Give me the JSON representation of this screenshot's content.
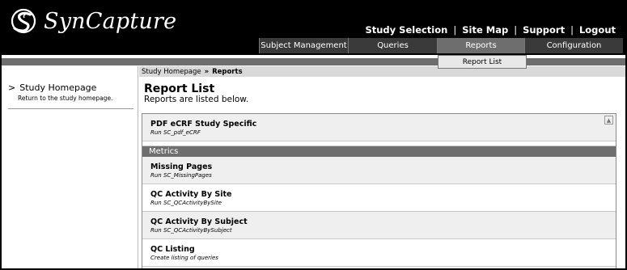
{
  "brand": {
    "name": "SynCapture",
    "logo_icon": "syncapture-s-logo-icon"
  },
  "top_links": {
    "study_selection": "Study Selection",
    "site_map": "Site Map",
    "support": "Support",
    "logout": "Logout",
    "separator": "|"
  },
  "nav_tabs": [
    {
      "label": "Subject Management",
      "active": false
    },
    {
      "label": "Queries",
      "active": false
    },
    {
      "label": "Reports",
      "active": true
    },
    {
      "label": "Configuration",
      "active": false
    }
  ],
  "dropdown": {
    "items": [
      "Report List"
    ]
  },
  "breadcrumb": {
    "home": "Study Homepage",
    "separator": "»",
    "current": "Reports"
  },
  "sidebar": {
    "items": [
      {
        "label": "Study Homepage",
        "description": "Return to the study homepage.",
        "icon": "chevron-right-icon",
        "icon_glyph": ">"
      }
    ]
  },
  "main": {
    "title": "Report List",
    "subtitle": "Reports are listed below."
  },
  "reports": {
    "top": [
      {
        "name": "PDF eCRF Study Specific",
        "description": "Run SC_pdf_eCRF"
      }
    ],
    "sections": [
      {
        "heading": "Metrics",
        "items": [
          {
            "name": "Missing Pages",
            "description": "Run SC_MissingPages"
          },
          {
            "name": "QC Activity By Site",
            "description": "Run SC_QCActivityBySite"
          },
          {
            "name": "QC Activity By Subject",
            "description": "Run SC_QCActivityBySubject"
          },
          {
            "name": "QC Listing",
            "description": "Create listing of queries"
          }
        ]
      }
    ]
  },
  "scrollbar": {
    "up_glyph": "▲"
  },
  "colors": {
    "header_bg": "#000000",
    "tab_bg": "#3a3a3a",
    "tab_active_bg": "#6e6e6e",
    "section_bg": "#6e6e6e",
    "row_shade": "#efefef"
  }
}
